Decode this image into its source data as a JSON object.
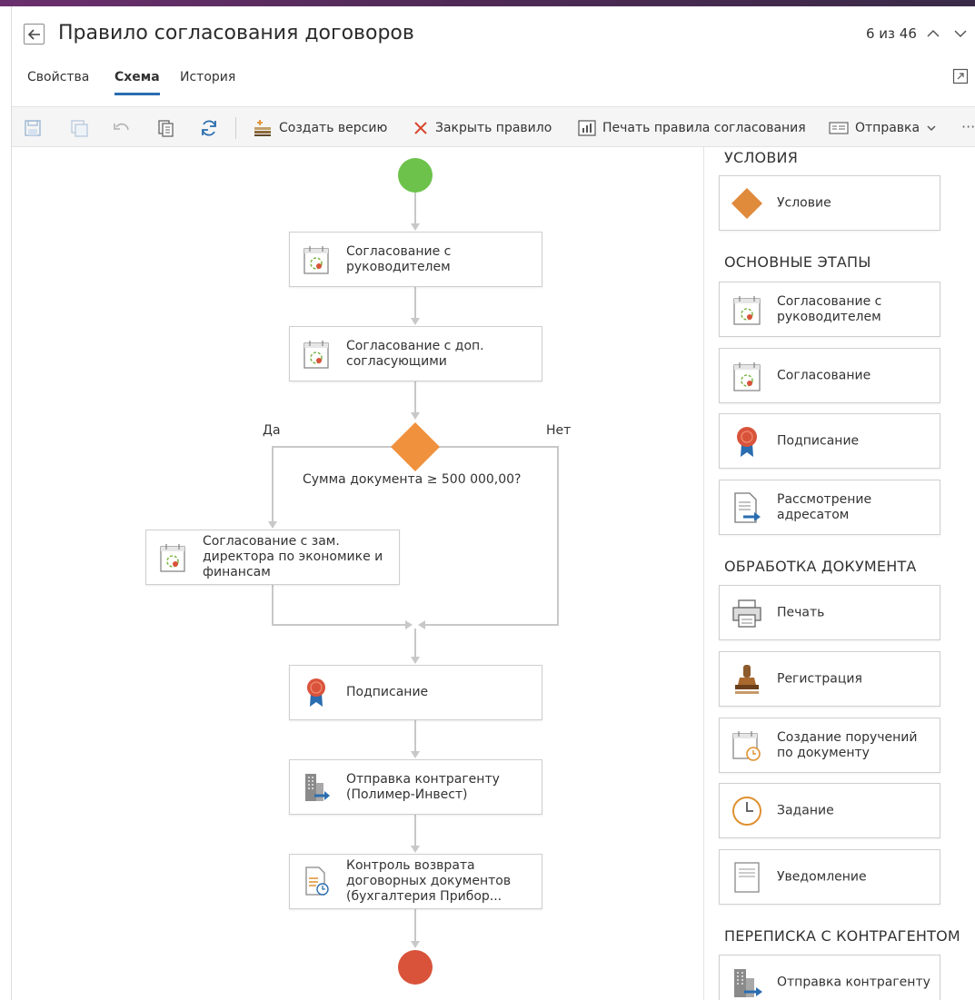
{
  "header": {
    "title": "Правило согласования договоров",
    "pager": "6 из 46"
  },
  "tabs": [
    {
      "label": "Свойства"
    },
    {
      "label": "Схема"
    },
    {
      "label": "История"
    }
  ],
  "toolbar": {
    "create_version": "Создать версию",
    "close_rule": "Закрыть правило",
    "print_rules": "Печать правила согласования",
    "send": "Отправка"
  },
  "flow": {
    "nodes": [
      {
        "label": "Согласование с руководителем"
      },
      {
        "label": "Согласование с доп. согласующими"
      },
      {
        "label": "Согласование с зам. директора по экономике и финансам"
      },
      {
        "label": "Подписание"
      },
      {
        "label": "Отправка контрагенту (Полимер-Инвест)"
      },
      {
        "label": "Контроль возврата договорных документов (бухгалтерия Прибор..."
      }
    ],
    "condition": {
      "label": "Сумма документа ≥ 500 000,00?",
      "yes": "Да",
      "no": "Нет"
    }
  },
  "palette": {
    "sections": [
      {
        "title": "УСЛОВИЯ",
        "items": [
          {
            "label": "Условие",
            "icon": "diamond-icon"
          }
        ]
      },
      {
        "title": "ОСНОВНЫЕ ЭТАПЫ",
        "items": [
          {
            "label": "Согласование с руководителем",
            "icon": "approval-calendar-icon"
          },
          {
            "label": "Согласование",
            "icon": "approval-calendar-icon"
          },
          {
            "label": "Подписание",
            "icon": "seal-ribbon-icon"
          },
          {
            "label": "Рассмотрение адресатом",
            "icon": "document-arrow-icon"
          }
        ]
      },
      {
        "title": "ОБРАБОТКА ДОКУМЕНТА",
        "items": [
          {
            "label": "Печать",
            "icon": "printer-icon"
          },
          {
            "label": "Регистрация",
            "icon": "stamp-icon"
          },
          {
            "label": "Создание поручений по документу",
            "icon": "calendar-clock-icon"
          },
          {
            "label": "Задание",
            "icon": "clock-icon"
          },
          {
            "label": "Уведомление",
            "icon": "notice-icon"
          }
        ]
      },
      {
        "title": "ПЕРЕПИСКА С КОНТРАГЕНТОМ",
        "items": [
          {
            "label": "Отправка контрагенту",
            "icon": "building-arrow-icon"
          }
        ]
      }
    ]
  },
  "colors": {
    "start": "#6cc24a",
    "end": "#d9533b",
    "condition": "#f0913d",
    "accent": "#2a6db0",
    "connector": "#c8c8c8"
  }
}
